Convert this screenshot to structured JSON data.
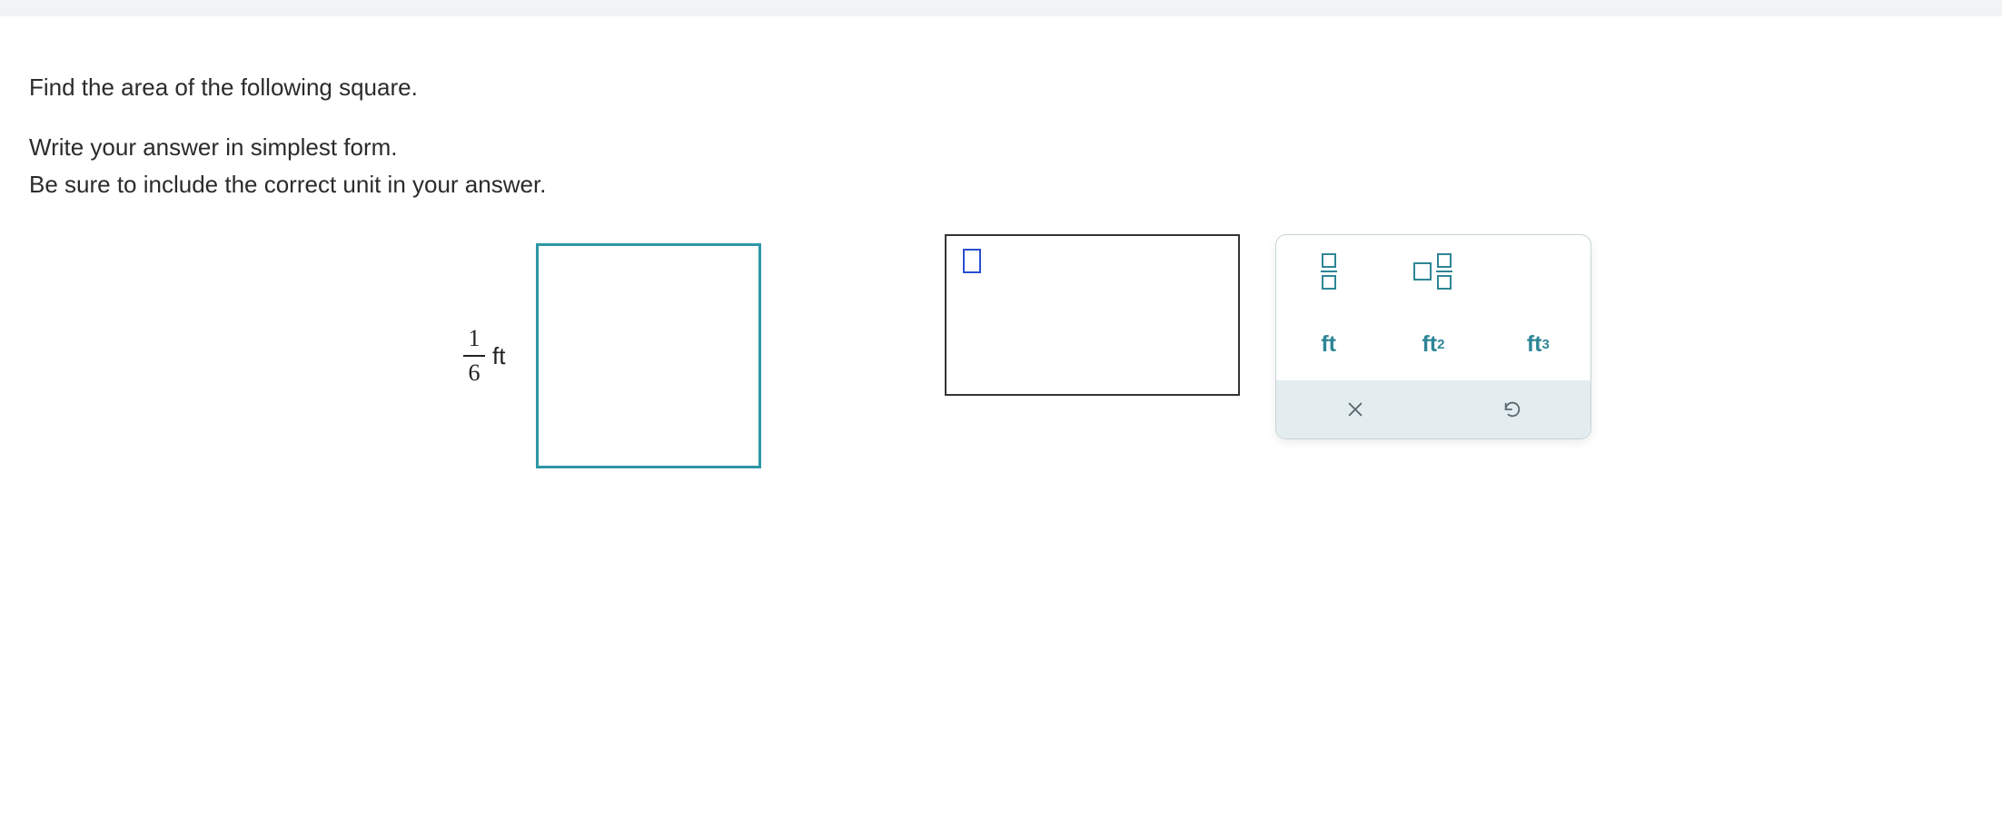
{
  "question": {
    "line1": "Find the area of the following square.",
    "line2": "Write your answer in simplest form.",
    "line3": "Be sure to include the correct unit in your answer."
  },
  "diagram": {
    "side_numerator": "1",
    "side_denominator": "6",
    "side_unit": "ft"
  },
  "toolbox": {
    "unit_ft": "ft",
    "unit_ft2_base": "ft",
    "unit_ft2_sup": "2",
    "unit_ft3_base": "ft",
    "unit_ft3_sup": "3"
  }
}
